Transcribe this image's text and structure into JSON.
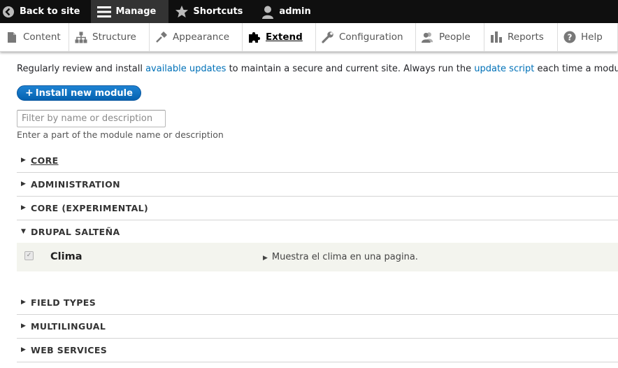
{
  "toolbar": {
    "back_label": "Back to site",
    "manage_label": "Manage",
    "shortcuts_label": "Shortcuts",
    "user_label": "admin"
  },
  "tray": {
    "items": [
      {
        "label": "Content",
        "icon": "page-icon"
      },
      {
        "label": "Structure",
        "icon": "sitemap-icon"
      },
      {
        "label": "Appearance",
        "icon": "paintbrush-icon"
      },
      {
        "label": "Extend",
        "icon": "puzzle-icon"
      },
      {
        "label": "Configuration",
        "icon": "wrench-icon"
      },
      {
        "label": "People",
        "icon": "people-icon"
      },
      {
        "label": "Reports",
        "icon": "bar-chart-icon"
      },
      {
        "label": "Help",
        "icon": "help-icon"
      }
    ],
    "active": "Extend"
  },
  "intro": {
    "text_before": "Regularly review and install ",
    "link1": "available updates",
    "text_middle": " to maintain a secure and current site. Always run the ",
    "link2": "update script",
    "text_after": " each time a modu"
  },
  "install_button": {
    "plus": "+",
    "label": "Install new module"
  },
  "filter": {
    "placeholder": "Filter by name or description",
    "value": "",
    "description": "Enter a part of the module name or description"
  },
  "sections": [
    {
      "label": "CORE",
      "expanded": false
    },
    {
      "label": "ADMINISTRATION",
      "expanded": false
    },
    {
      "label": "CORE (EXPERIMENTAL)",
      "expanded": false
    },
    {
      "label": "DRUPAL SALTEÑA",
      "expanded": true
    },
    {
      "label": "FIELD TYPES",
      "expanded": false
    },
    {
      "label": "MULTILINGUAL",
      "expanded": false
    },
    {
      "label": "WEB SERVICES",
      "expanded": false
    }
  ],
  "module": {
    "name": "Clima",
    "description": "Muestra el clima en una pagina.",
    "enabled": true
  },
  "colors": {
    "toolbar_bg": "#0f0f0f",
    "manage_bg": "#333333",
    "link": "#0071b8",
    "button": "#0a6bbf",
    "row_bg": "#f3f4ee"
  }
}
